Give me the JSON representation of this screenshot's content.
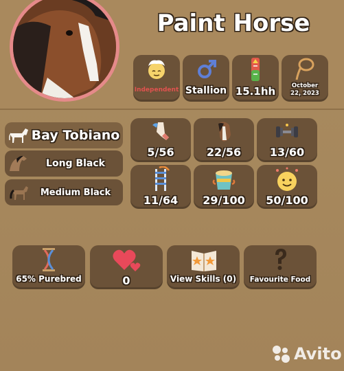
{
  "header": {
    "breed_title": "Paint Horse"
  },
  "info_badges": [
    {
      "name": "temperament",
      "label": "Independent",
      "icon": "calm-face-icon"
    },
    {
      "name": "gender",
      "label": "Stallion",
      "icon": "male-symbol-icon"
    },
    {
      "name": "height",
      "label": "15.1hh",
      "icon": "height-ruler-icon"
    },
    {
      "name": "birthday",
      "label": "October 22, 2023",
      "icon": "lasso-icon"
    }
  ],
  "coats": [
    {
      "name": "coat-color",
      "label": "Bay Tobiano"
    },
    {
      "name": "mane-color",
      "label": "Long Black"
    },
    {
      "name": "tail-color",
      "label": "Medium Black"
    }
  ],
  "stats": [
    {
      "name": "speed",
      "value": "5/56",
      "icon": "horseshoe-leg-icon"
    },
    {
      "name": "stamina",
      "value": "22/56",
      "icon": "horse-head-icon"
    },
    {
      "name": "strength",
      "value": "13/60",
      "icon": "dumbbell-icon"
    },
    {
      "name": "jump",
      "value": "11/64",
      "icon": "ladder-jump-icon"
    },
    {
      "name": "hunger",
      "value": "29/100",
      "icon": "feed-bucket-icon"
    },
    {
      "name": "happiness",
      "value": "50/100",
      "icon": "happy-face-icon"
    }
  ],
  "bottom_buttons": [
    {
      "name": "purebred",
      "label": "65% Purebred",
      "icon": "dna-hourglass-icon"
    },
    {
      "name": "love",
      "label": "0",
      "icon": "hearts-icon"
    },
    {
      "name": "skills",
      "label": "View Skills (0)",
      "icon": "skill-book-icon"
    },
    {
      "name": "favourite-food",
      "label": "Favourite Food",
      "icon": "question-mark-icon"
    }
  ],
  "watermark": {
    "text": "Avito"
  },
  "colors": {
    "background": "#a98b5f",
    "card": "#6b5238",
    "portrait_ring": "#e58a8a",
    "temperament_text": "#e0524f"
  }
}
